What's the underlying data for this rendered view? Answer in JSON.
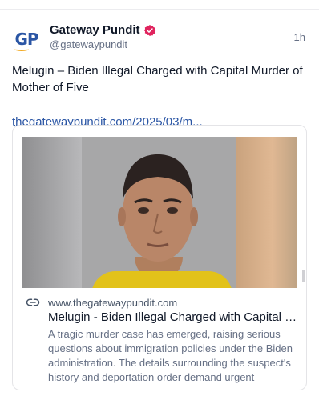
{
  "post": {
    "author_name": "Gateway Pundit",
    "author_handle": "@gatewaypundit",
    "avatar_text": "GP",
    "timestamp": "1h",
    "text": "Melugin – Biden Illegal Charged with Capital Murder of Mother of Five",
    "link_text": "thegatewaypundit.com/2025/03/m...",
    "verified_badge_icon": "verified-badge-icon"
  },
  "card": {
    "icon": "link-icon",
    "domain": "www.thegatewaypundit.com",
    "title": "Melugin - Biden Illegal Charged with Capital M...",
    "description": "A tragic murder case has emerged, raising serious questions about immigration policies under the Biden administration. The details surrounding the suspect's history and deportation order demand urgent attentio..."
  },
  "colors": {
    "brand_blue": "#2a55a4",
    "verified_red": "#e0245e",
    "shirt_yellow": "#e2c21a",
    "muted_text": "#667085"
  }
}
